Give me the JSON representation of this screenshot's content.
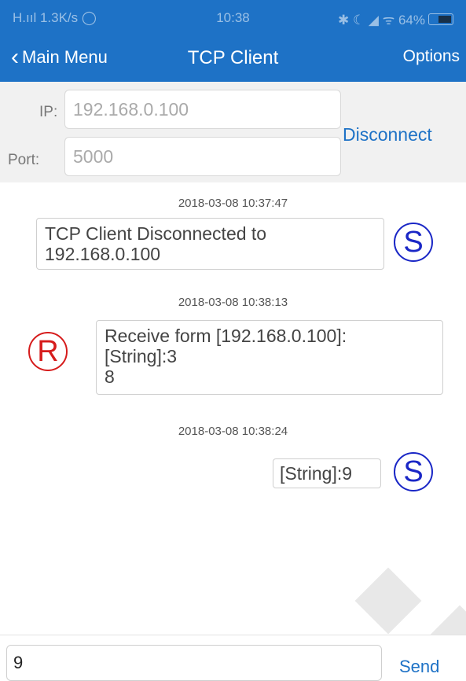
{
  "status_bar": {
    "signal": "H.ııl 1.3K/s ◯",
    "time": "10:38",
    "right": "✱ ☾ ◢ ᯤ 64%"
  },
  "nav": {
    "back_label": "Main Menu",
    "title": "TCP Client",
    "options_label": "Options"
  },
  "connection": {
    "ip_label": "IP:",
    "ip_placeholder": "192.168.0.100",
    "port_label": "Port:",
    "port_placeholder": "5000",
    "disconnect_label": "Disconnect"
  },
  "messages": [
    {
      "timestamp": "2018-03-08 10:37:47",
      "direction": "sent",
      "avatar": "S",
      "text": "TCP Client Disconnected to\n192.168.0.100"
    },
    {
      "timestamp": "2018-03-08 10:38:13",
      "direction": "received",
      "avatar": "R",
      "text": "Receive form [192.168.0.100]:\n[String]:3\n8"
    },
    {
      "timestamp": "2018-03-08 10:38:24",
      "direction": "sent",
      "avatar": "S",
      "text": "[String]:9"
    }
  ],
  "composer": {
    "value": "9",
    "send_label": "Send"
  },
  "colors": {
    "accent": "#1e72c6",
    "sent_avatar": "#1a27c6",
    "received_avatar": "#d61c1c"
  }
}
